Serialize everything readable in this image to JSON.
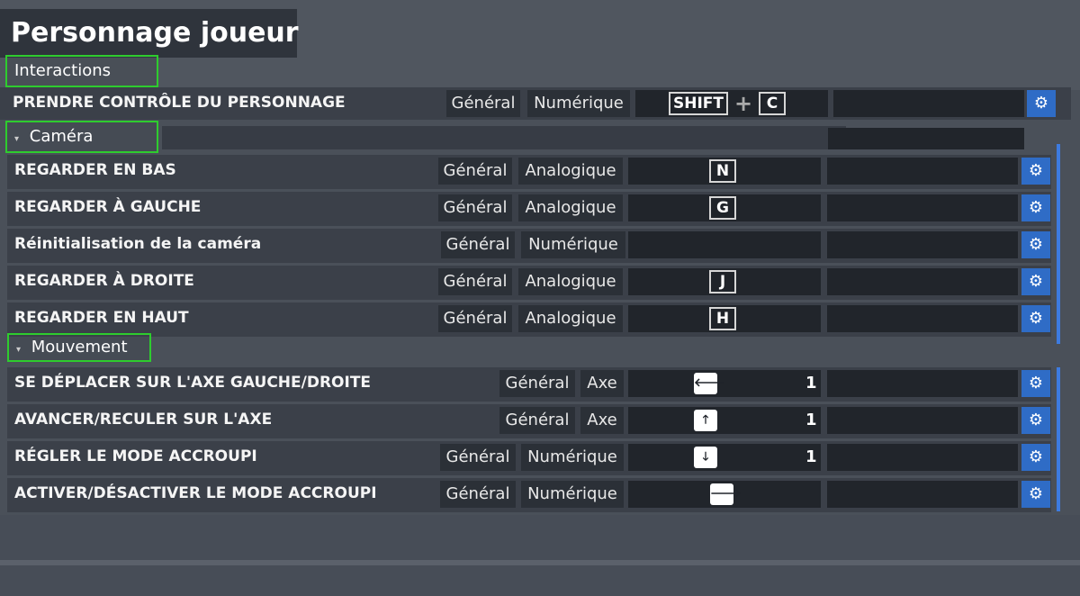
{
  "page_title": "Personnage joueur",
  "sections": {
    "interactions": "Interactions",
    "camera": "Caméra",
    "mouvement": "Mouvement"
  },
  "interactions_rows": [
    {
      "label": "PRENDRE CONTRÔLE DU PERSONNAGE",
      "category": "Général",
      "type": "Numérique",
      "keys": [
        "SHIFT",
        "C"
      ],
      "plus": "+"
    }
  ],
  "camera_rows": [
    {
      "label": "REGARDER EN BAS",
      "category": "Général",
      "type": "Analogique",
      "key": "N"
    },
    {
      "label": "REGARDER À GAUCHE",
      "category": "Général",
      "type": "Analogique",
      "key": "G"
    },
    {
      "label": "Réinitialisation de la caméra",
      "category": "Général",
      "type": "Numérique",
      "key": ""
    },
    {
      "label": "REGARDER À DROITE",
      "category": "Général",
      "type": "Analogique",
      "key": "J"
    },
    {
      "label": "REGARDER EN HAUT",
      "category": "Général",
      "type": "Analogique",
      "key": "H"
    }
  ],
  "mouvement_rows": [
    {
      "label": "SE DÉPLACER SUR L'AXE GAUCHE/DROITE",
      "category": "Général",
      "type": "Axe",
      "key_icon": "arrow-left-icon",
      "key_glyph": "🡐",
      "value": "1"
    },
    {
      "label": "AVANCER/RECULER SUR L'AXE",
      "category": "Général",
      "type": "Axe",
      "key_icon": "arrow-up-icon",
      "key_glyph": "🡑",
      "value": "1"
    },
    {
      "label": "RÉGLER LE MODE ACCROUPI",
      "category": "Général",
      "type": "Numérique",
      "key_icon": "arrow-down-icon",
      "key_glyph": "🡓",
      "value": "1"
    },
    {
      "label": "ACTIVER/DÉSACTIVER LE MODE ACCROUPI",
      "category": "Général",
      "type": "Numérique",
      "key_icon": "arrow-right-icon",
      "key_glyph": "🡒",
      "value": ""
    }
  ],
  "gear_glyph": "⚙",
  "colors": {
    "section_border": "#2ecc2e",
    "gear_button": "#2f6cc6",
    "scrollbar": "#3d7be0",
    "background": "#4a5059"
  }
}
